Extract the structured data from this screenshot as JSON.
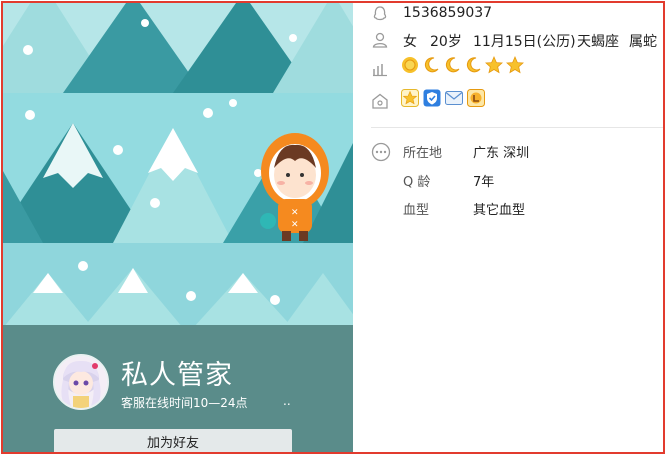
{
  "profile": {
    "qq_number": "1536859037",
    "gender": "女",
    "age": "20岁",
    "birthday": "11月15日(公历)",
    "constellation": "天蝎座",
    "zodiac": "属蛇",
    "nickname": "私人管家",
    "signature": "客服在线时间10—24点",
    "signature_more": "..",
    "add_friend_label": "加为好友"
  },
  "level_icons": [
    "sun-icon",
    "moon-icon",
    "moon-icon",
    "moon-icon",
    "star-icon",
    "star-icon"
  ],
  "badge_icons": [
    "vip-star-badge-icon",
    "shield-badge-icon",
    "mail-badge-icon",
    "game-badge-icon"
  ],
  "details": {
    "location_label": "所在地",
    "location_value": "广东 深圳",
    "qage_label": "Q 龄",
    "qage_value": "7年",
    "blood_label": "血型",
    "blood_value": "其它血型"
  },
  "colors": {
    "frame": "#e23b2e",
    "panel": "#5a8c8a",
    "tree_dark": "#2f8f96",
    "tree_light": "#a8e2e3"
  }
}
